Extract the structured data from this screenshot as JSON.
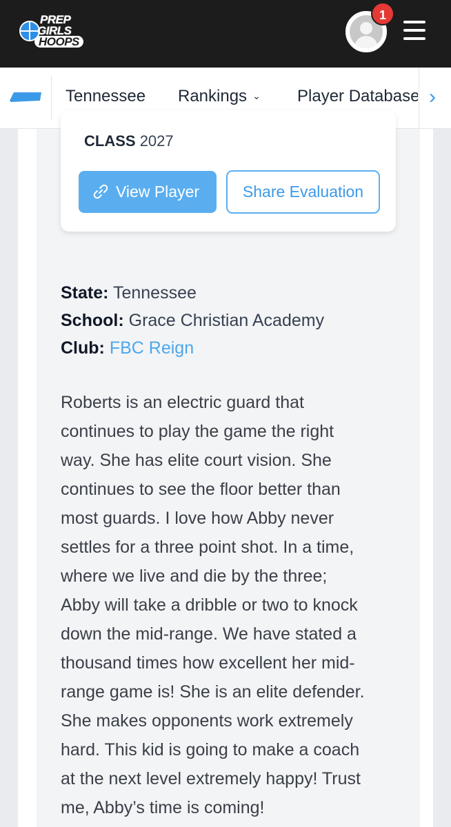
{
  "header": {
    "logo": [
      "PREP",
      "GIRLS",
      "HOOPS"
    ],
    "notification_count": "1"
  },
  "nav": {
    "items": [
      {
        "label": "Tennessee"
      },
      {
        "label": "Rankings"
      },
      {
        "label": "Player Database"
      }
    ]
  },
  "card": {
    "class_label": "CLASS",
    "class_year": "2027",
    "view_button": "View Player",
    "share_button": "Share Evaluation"
  },
  "info": {
    "state_label": "State:",
    "state_value": "Tennessee",
    "school_label": "School:",
    "school_value": "Grace Christian Academy",
    "club_label": "Club:",
    "club_value": "FBC Reign"
  },
  "evaluation": {
    "lines": [
      "Roberts is an electric guard that",
      "continues to play the game the right",
      "way. She has elite court vision. She",
      "continues to see the floor better than",
      "most guards. I love how Abby never",
      "settles for a three point shot. In a time,",
      "where we live and die by the three;",
      "Abby will take a dribble or two to knock",
      "down the mid-range. We have stated a",
      "thousand times how excellent her mid-",
      "range game is! She is an elite defender.",
      "She makes opponents work extremely",
      "hard. This kid is going to make a coach",
      "at the next level extremely happy! Trust",
      "me, Abby’s time is coming!"
    ]
  },
  "colors": {
    "header_bg": "#1c1c1c",
    "accent": "#5aaef0",
    "badge": "#e53935"
  }
}
